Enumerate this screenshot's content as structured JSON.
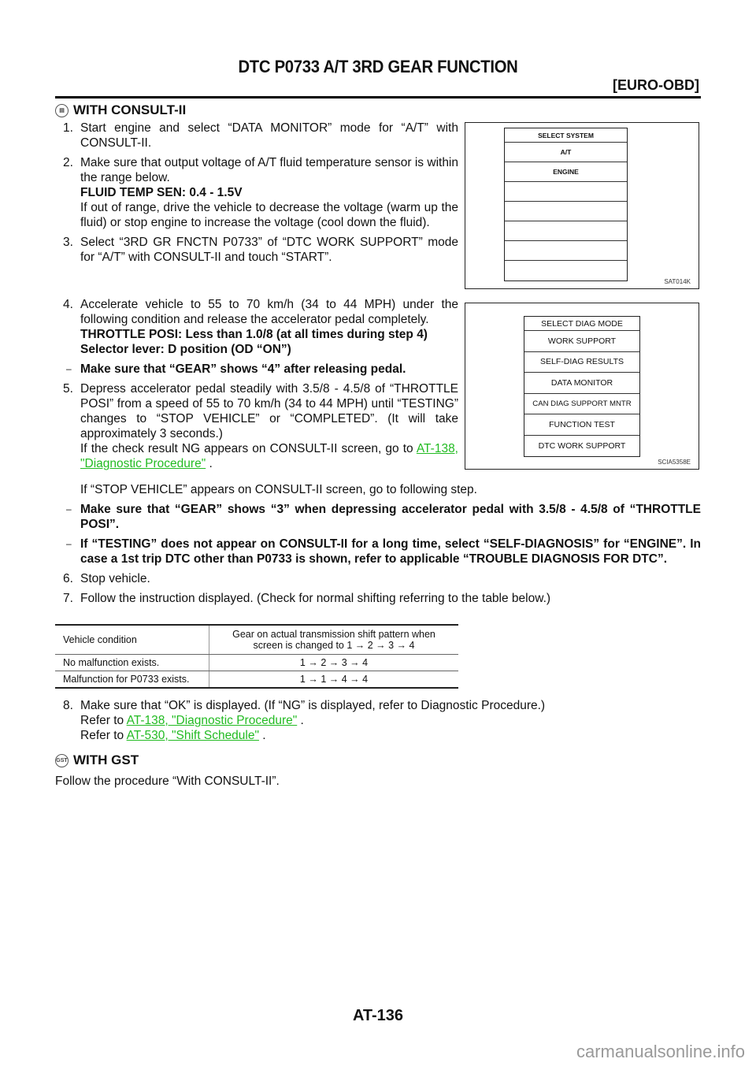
{
  "header": {
    "title": "DTC P0733 A/T 3RD GEAR FUNCTION",
    "subtitle": "[EURO-OBD]"
  },
  "consult_section": {
    "icon": "consult-tool-icon",
    "icon_glyph": "▤",
    "heading": "WITH CONSULT-II",
    "steps": [
      {
        "num": "1.",
        "text": "Start engine and select “DATA MONITOR” mode for “A/T” with CONSULT-II."
      },
      {
        "num": "2.",
        "text": "Make sure that output voltage of A/T fluid temperature sensor is within the range below.",
        "spec": "FLUID TEMP SEN: 0.4 - 1.5V",
        "note": "If out of range, drive the vehicle to decrease the voltage (warm up the fluid) or stop engine to increase the voltage (cool down the fluid)."
      },
      {
        "num": "3.",
        "text": "Select “3RD GR FNCTN P0733” of “DTC WORK SUPPORT” mode for “A/T” with CONSULT-II and touch “START”."
      },
      {
        "num": "4.",
        "text": "Accelerate vehicle to 55 to 70 km/h (34 to 44 MPH) under the following condition and release the accelerator pedal completely.",
        "spec1": "THROTTLE POSI: Less than 1.0/8 (at all times during step 4)",
        "spec2": "Selector lever: D position (OD “ON”)",
        "dash": "Make sure that “GEAR” shows “4” after releasing pedal."
      },
      {
        "num": "5.",
        "text": "Depress accelerator pedal steadily with 3.5/8 - 4.5/8 of “THROTTLE POSI” from a speed of 55 to 70 km/h (34 to 44 MPH) until “TESTING” changes to “STOP VEHICLE” or “COMPLETED”. (It will take approximately 3 seconds.)",
        "ng_prefix": "If the check result NG appears on CONSULT-II screen, go to ",
        "ng_link": "AT-138, \"Diagnostic Procedure\"",
        "ng_suffix": " .",
        "stop_note": "If “STOP VEHICLE” appears on CONSULT-II screen, go to following step.",
        "dash1": "Make sure that “GEAR” shows “3” when depressing accelerator pedal with 3.5/8 - 4.5/8 of “THROTTLE POSI”.",
        "dash2": "If “TESTING” does not appear on CONSULT-II for a long time, select “SELF-DIAGNOSIS” for “ENGINE”. In case a 1st trip DTC other than P0733 is shown, refer to applicable “TROUBLE DIAGNOSIS FOR DTC”."
      },
      {
        "num": "6.",
        "text": "Stop vehicle."
      },
      {
        "num": "7.",
        "text": "Follow the instruction displayed. (Check for normal shifting referring to the table below.)"
      },
      {
        "num": "8.",
        "text": "Make sure that “OK” is displayed. (If “NG” is displayed, refer to Diagnostic Procedure.)",
        "ref_prefix": "Refer to ",
        "ref1": "AT-138, \"Diagnostic Procedure\"",
        "ref2": "AT-530, \"Shift Schedule\"",
        "ref_suffix": " ."
      }
    ],
    "dash_glyph": "–"
  },
  "figures": {
    "select_system": {
      "header": "SELECT SYSTEM",
      "items": [
        "A/T",
        "ENGINE",
        "",
        "",
        "",
        "",
        ""
      ],
      "code": "SAT014K"
    },
    "select_diag_mode": {
      "header": "SELECT DIAG MODE",
      "items": [
        "WORK SUPPORT",
        "SELF-DIAG RESULTS",
        "DATA MONITOR",
        "CAN DIAG SUPPORT MNTR",
        "FUNCTION TEST",
        "DTC WORK SUPPORT"
      ],
      "code": "SCIA5358E"
    }
  },
  "shift_table": {
    "headers": [
      "Vehicle condition",
      "Gear on actual transmission shift pattern when screen is changed to 1 → 2 → 3 → 4"
    ],
    "rows": [
      [
        "No malfunction exists.",
        "1 → 2 → 3 → 4"
      ],
      [
        "Malfunction for P0733 exists.",
        "1 → 1 → 4 → 4"
      ]
    ]
  },
  "gst_section": {
    "icon": "gst-tool-icon",
    "icon_glyph": "GST",
    "heading": "WITH GST",
    "text": "Follow the procedure “With CONSULT-II”."
  },
  "footer": {
    "page_number": "AT-136",
    "watermark": "carmanualsonline.info"
  }
}
